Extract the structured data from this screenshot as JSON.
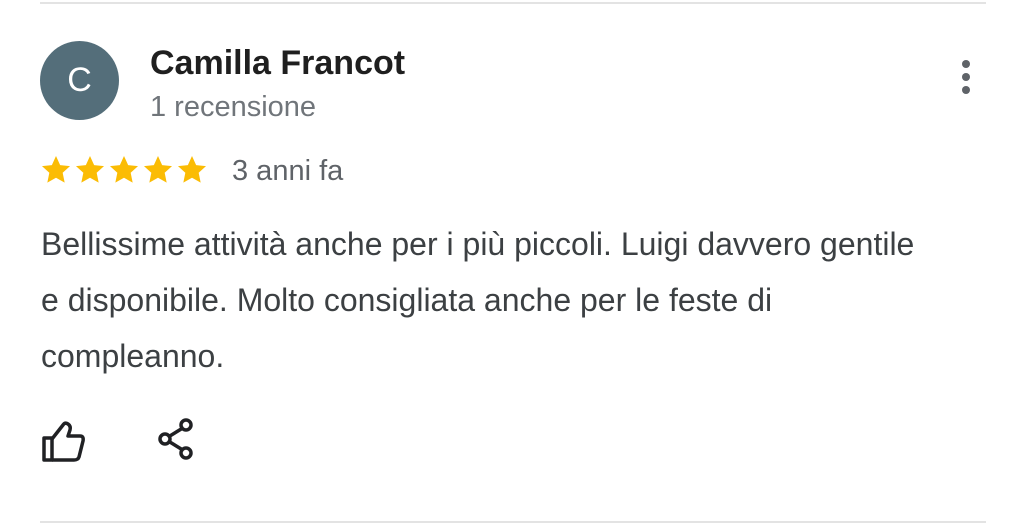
{
  "review": {
    "avatar_letter": "C",
    "avatar_color": "#546e7a",
    "reviewer_name": "Camilla Francot",
    "review_count": "1 recensione",
    "rating": 5,
    "rating_max": 5,
    "star_color": "#fbbc04",
    "time_ago": "3 anni fa",
    "text": "Bellissime attività anche per i più piccoli. Luigi davvero gentile e disponibile. Molto consigliata anche per le feste di compleanno."
  },
  "icons": {
    "more": "more-vertical-icon",
    "like": "thumbs-up-icon",
    "share": "share-icon",
    "star": "star-icon"
  }
}
